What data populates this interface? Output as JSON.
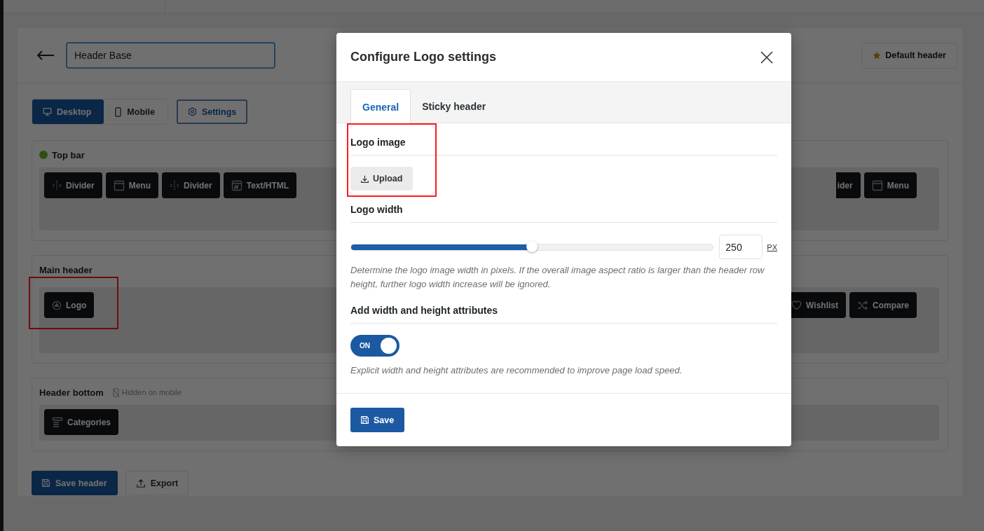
{
  "builder": {
    "name_field": {
      "value": "Header Base"
    },
    "default_button": "Default header",
    "device_tabs": [
      {
        "label": "Desktop",
        "kind": "desktop",
        "selected": true
      },
      {
        "label": "Mobile",
        "kind": "mobile",
        "selected": false
      }
    ],
    "settings_button": "Settings",
    "rows": [
      {
        "title": "Top bar",
        "status_dot": true,
        "left_items": [
          {
            "label": "Divider",
            "kind": "divider",
            "highlighted": false
          },
          {
            "label": "Menu",
            "kind": "menu",
            "highlighted": false
          },
          {
            "label": "Divider",
            "kind": "divider",
            "highlighted": false
          },
          {
            "label": "Text/HTML",
            "kind": "text_html",
            "highlighted": false
          }
        ],
        "right_items": [
          {
            "label": "ider",
            "kind": "partial",
            "highlighted": false
          },
          {
            "label": "Menu",
            "kind": "menu",
            "highlighted": false
          }
        ]
      },
      {
        "title": "Main header",
        "status_dot": false,
        "left_items": [
          {
            "label": "Logo",
            "kind": "logo",
            "highlighted": true
          }
        ],
        "right_items": [
          {
            "label": "Wishlist",
            "kind": "wishlist",
            "highlighted": false
          },
          {
            "label": "Compare",
            "kind": "compare",
            "highlighted": false
          }
        ]
      },
      {
        "title": "Header bottom",
        "status_dot": false,
        "note": "Hidden on mobile",
        "left_items": [
          {
            "label": "Categories",
            "kind": "categories",
            "highlighted": false
          }
        ],
        "right_items": []
      }
    ],
    "actions": [
      {
        "label": "Save header",
        "kind": "primary"
      },
      {
        "label": "Export",
        "kind": "secondary"
      }
    ]
  },
  "modal": {
    "title": "Configure Logo settings",
    "tabs": [
      {
        "label": "General",
        "selected": true
      },
      {
        "label": "Sticky header",
        "selected": false
      }
    ],
    "sections": [
      {
        "kind": "upload",
        "title": "Logo image",
        "button": "Upload",
        "highlighted": true
      },
      {
        "kind": "slider",
        "title": "Logo width",
        "level": 0.5,
        "value": "250",
        "unit": "PX",
        "help": "Determine the logo image width in pixels. If the overall image aspect ratio is larger than the header row height, further logo width increase will be ignored.",
        "highlighted": false
      },
      {
        "kind": "toggle",
        "title": "Add width and height attributes",
        "on": true,
        "toggle_label": "ON",
        "help": "Explicit width and height attributes are recommended to improve page load speed.",
        "highlighted": false
      }
    ],
    "save_button": "Save"
  }
}
